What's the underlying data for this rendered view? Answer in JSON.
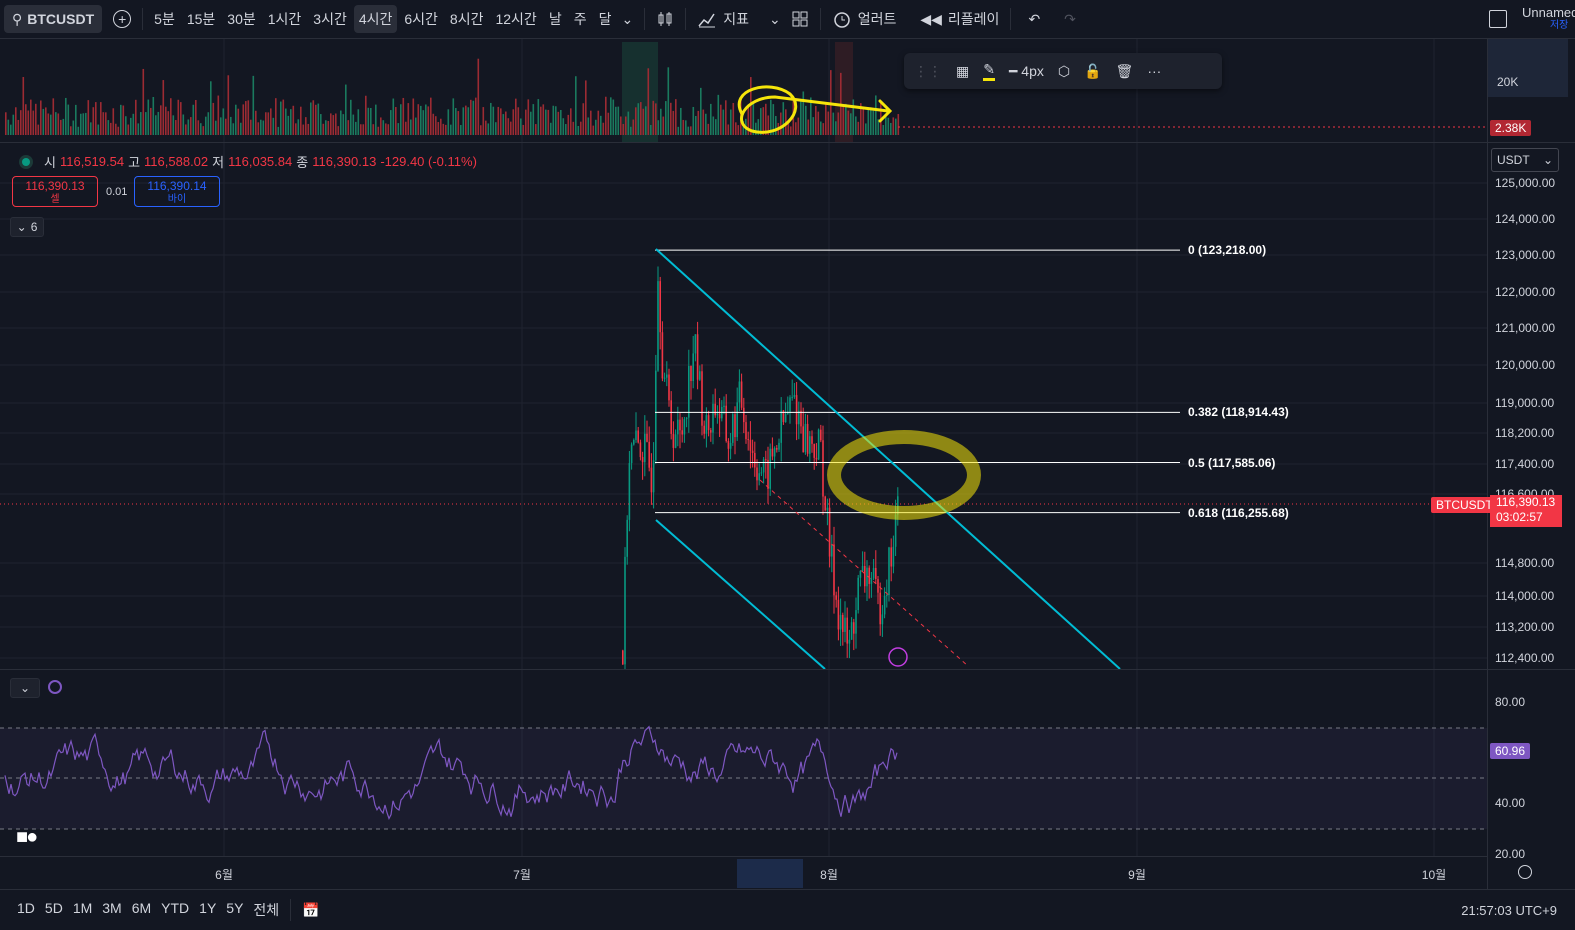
{
  "toolbar": {
    "symbol": "BTCUSDT",
    "intervals": [
      "5분",
      "15분",
      "30분",
      "1시간",
      "3시간",
      "4시간",
      "6시간",
      "8시간",
      "12시간",
      "날",
      "주",
      "달"
    ],
    "active_interval": "4시간",
    "indicators_label": "지표",
    "alert_label": "얼러트",
    "replay_label": "리플레이",
    "layout_name": "Unnamed",
    "save_label": "저장"
  },
  "legend": {
    "open_key": "시",
    "open": "116,519.54",
    "high_key": "고",
    "high": "116,588.02",
    "low_key": "저",
    "low": "116,035.84",
    "close_key": "종",
    "close": "116,390.13",
    "change": "-129.40 (-0.11%)"
  },
  "trade": {
    "sell_price": "116,390.13",
    "sell_label": "셀",
    "spread": "0.01",
    "buy_price": "116,390.14",
    "buy_label": "바이"
  },
  "indicator_count": "6",
  "drawing_toolbar": {
    "width_label": "4px"
  },
  "volume_scale": {
    "top_label": "20K",
    "current": "2.38K"
  },
  "currency": "USDT",
  "price_scale": [
    "125,000.00",
    "124,000.00",
    "123,000.00",
    "122,000.00",
    "121,000.00",
    "120,000.00",
    "119,000.00",
    "118,200.00",
    "117,400.00",
    "116,600.00",
    "114,800.00",
    "114,000.00",
    "113,200.00",
    "112,400.00"
  ],
  "price_tag": {
    "symbol": "BTCUSDT",
    "price": "116,390.13",
    "countdown": "03:02:57"
  },
  "fib_levels": [
    {
      "label": "0 (123,218.00)",
      "price": 123218.0
    },
    {
      "label": "0.382 (118,914.43)",
      "price": 118914.43
    },
    {
      "label": "0.5 (117,585.06)",
      "price": 117585.06
    },
    {
      "label": "0.618 (116,255.68)",
      "price": 116255.68
    }
  ],
  "rsi": {
    "scale": [
      "80.00",
      "60.00",
      "40.00",
      "20.00"
    ],
    "current": "60.96"
  },
  "time_axis": [
    "6월",
    "7월",
    "8월",
    "9월",
    "10월"
  ],
  "bottom": {
    "ranges": [
      "1D",
      "5D",
      "1M",
      "3M",
      "6M",
      "YTD",
      "1Y",
      "5Y",
      "전체"
    ],
    "clock": "21:57:03 UTC+9"
  },
  "colors": {
    "up": "#089981",
    "down": "#f23645",
    "channel": "#00bcd4",
    "highlight": "#f5e50a",
    "rsi": "#7e57c2"
  }
}
